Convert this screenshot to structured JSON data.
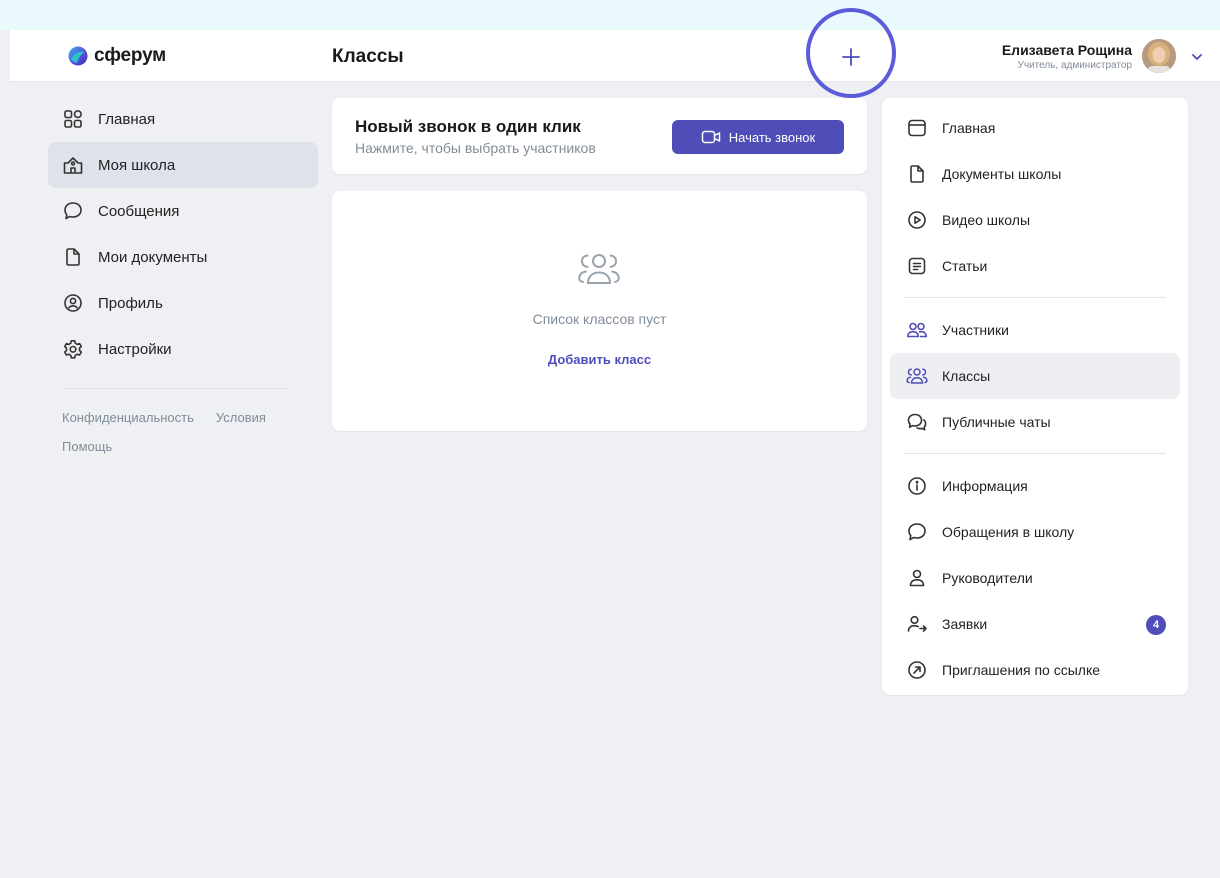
{
  "header": {
    "logo_text": "сферум",
    "page_title": "Классы",
    "user": {
      "name": "Елизавета Рощина",
      "role": "Учитель, администратор"
    }
  },
  "left_nav": {
    "items": [
      {
        "label": "Главная",
        "icon": "home-grid-icon"
      },
      {
        "label": "Моя школа",
        "icon": "school-icon",
        "active": true
      },
      {
        "label": "Сообщения",
        "icon": "message-icon"
      },
      {
        "label": "Мои документы",
        "icon": "document-icon"
      },
      {
        "label": "Профиль",
        "icon": "profile-icon"
      },
      {
        "label": "Настройки",
        "icon": "gear-icon"
      }
    ],
    "footer_links": {
      "privacy": "Конфиденциальность",
      "terms": "Условия",
      "help": "Помощь"
    }
  },
  "call_card": {
    "title": "Новый звонок в один клик",
    "subtitle": "Нажмите, чтобы выбрать участников",
    "button_label": "Начать звонок"
  },
  "classes_card": {
    "empty_text": "Список классов пуст",
    "add_label": "Добавить класс"
  },
  "right_panel": {
    "items": [
      {
        "label": "Главная",
        "icon": "window-icon"
      },
      {
        "label": "Документы школы",
        "icon": "document-icon"
      },
      {
        "label": "Видео школы",
        "icon": "play-icon"
      },
      {
        "label": "Статьи",
        "icon": "article-icon"
      },
      {
        "label": "Участники",
        "icon": "users-icon"
      },
      {
        "label": "Классы",
        "icon": "classes-icon",
        "active": true
      },
      {
        "label": "Публичные чаты",
        "icon": "chats-icon"
      },
      {
        "label": "Информация",
        "icon": "info-icon"
      },
      {
        "label": "Обращения в школу",
        "icon": "message-icon"
      },
      {
        "label": "Руководители",
        "icon": "person-icon"
      },
      {
        "label": "Заявки",
        "icon": "user-arrow-icon",
        "badge": "4"
      },
      {
        "label": "Приглашения по ссылке",
        "icon": "link-arrow-icon"
      }
    ]
  },
  "colors": {
    "accent": "#4f4db8",
    "highlight_ring": "#5b5cdb",
    "background": "#eef0f3",
    "muted_text": "#818c99"
  }
}
